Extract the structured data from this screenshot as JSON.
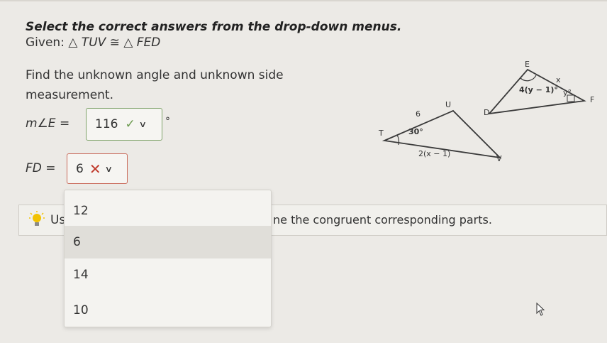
{
  "instructions": {
    "title": "Select the correct answers from the drop-down menus.",
    "given_prefix": "Given:",
    "given_math": "△ TUV ≅ △ FED",
    "task": "Find the unknown angle and unknown side measurement."
  },
  "questions": [
    {
      "label": "m∠E =",
      "selected": "116",
      "status": "correct",
      "unit": "°"
    },
    {
      "label": "FD =",
      "selected": "6",
      "status": "incorrect"
    }
  ],
  "dropdown": {
    "options": [
      "12",
      "6",
      "14",
      "10"
    ],
    "highlighted": "6"
  },
  "hint": {
    "text_start": "Us",
    "text_end": "ne the congruent corresponding parts."
  },
  "figure": {
    "triangle1": {
      "vertices": [
        "T",
        "U",
        "V"
      ],
      "side_TU": "6",
      "angle_T": "30°",
      "side_TV": "2(x − 1)"
    },
    "triangle2": {
      "vertices": [
        "D",
        "E",
        "F"
      ],
      "angle_E": "4(y − 1)°",
      "side_EF": "x",
      "angle_F": "y°"
    }
  },
  "colors": {
    "correct": "#6b9a4e",
    "incorrect": "#c0392b",
    "hint_icon": "#f2c200"
  }
}
